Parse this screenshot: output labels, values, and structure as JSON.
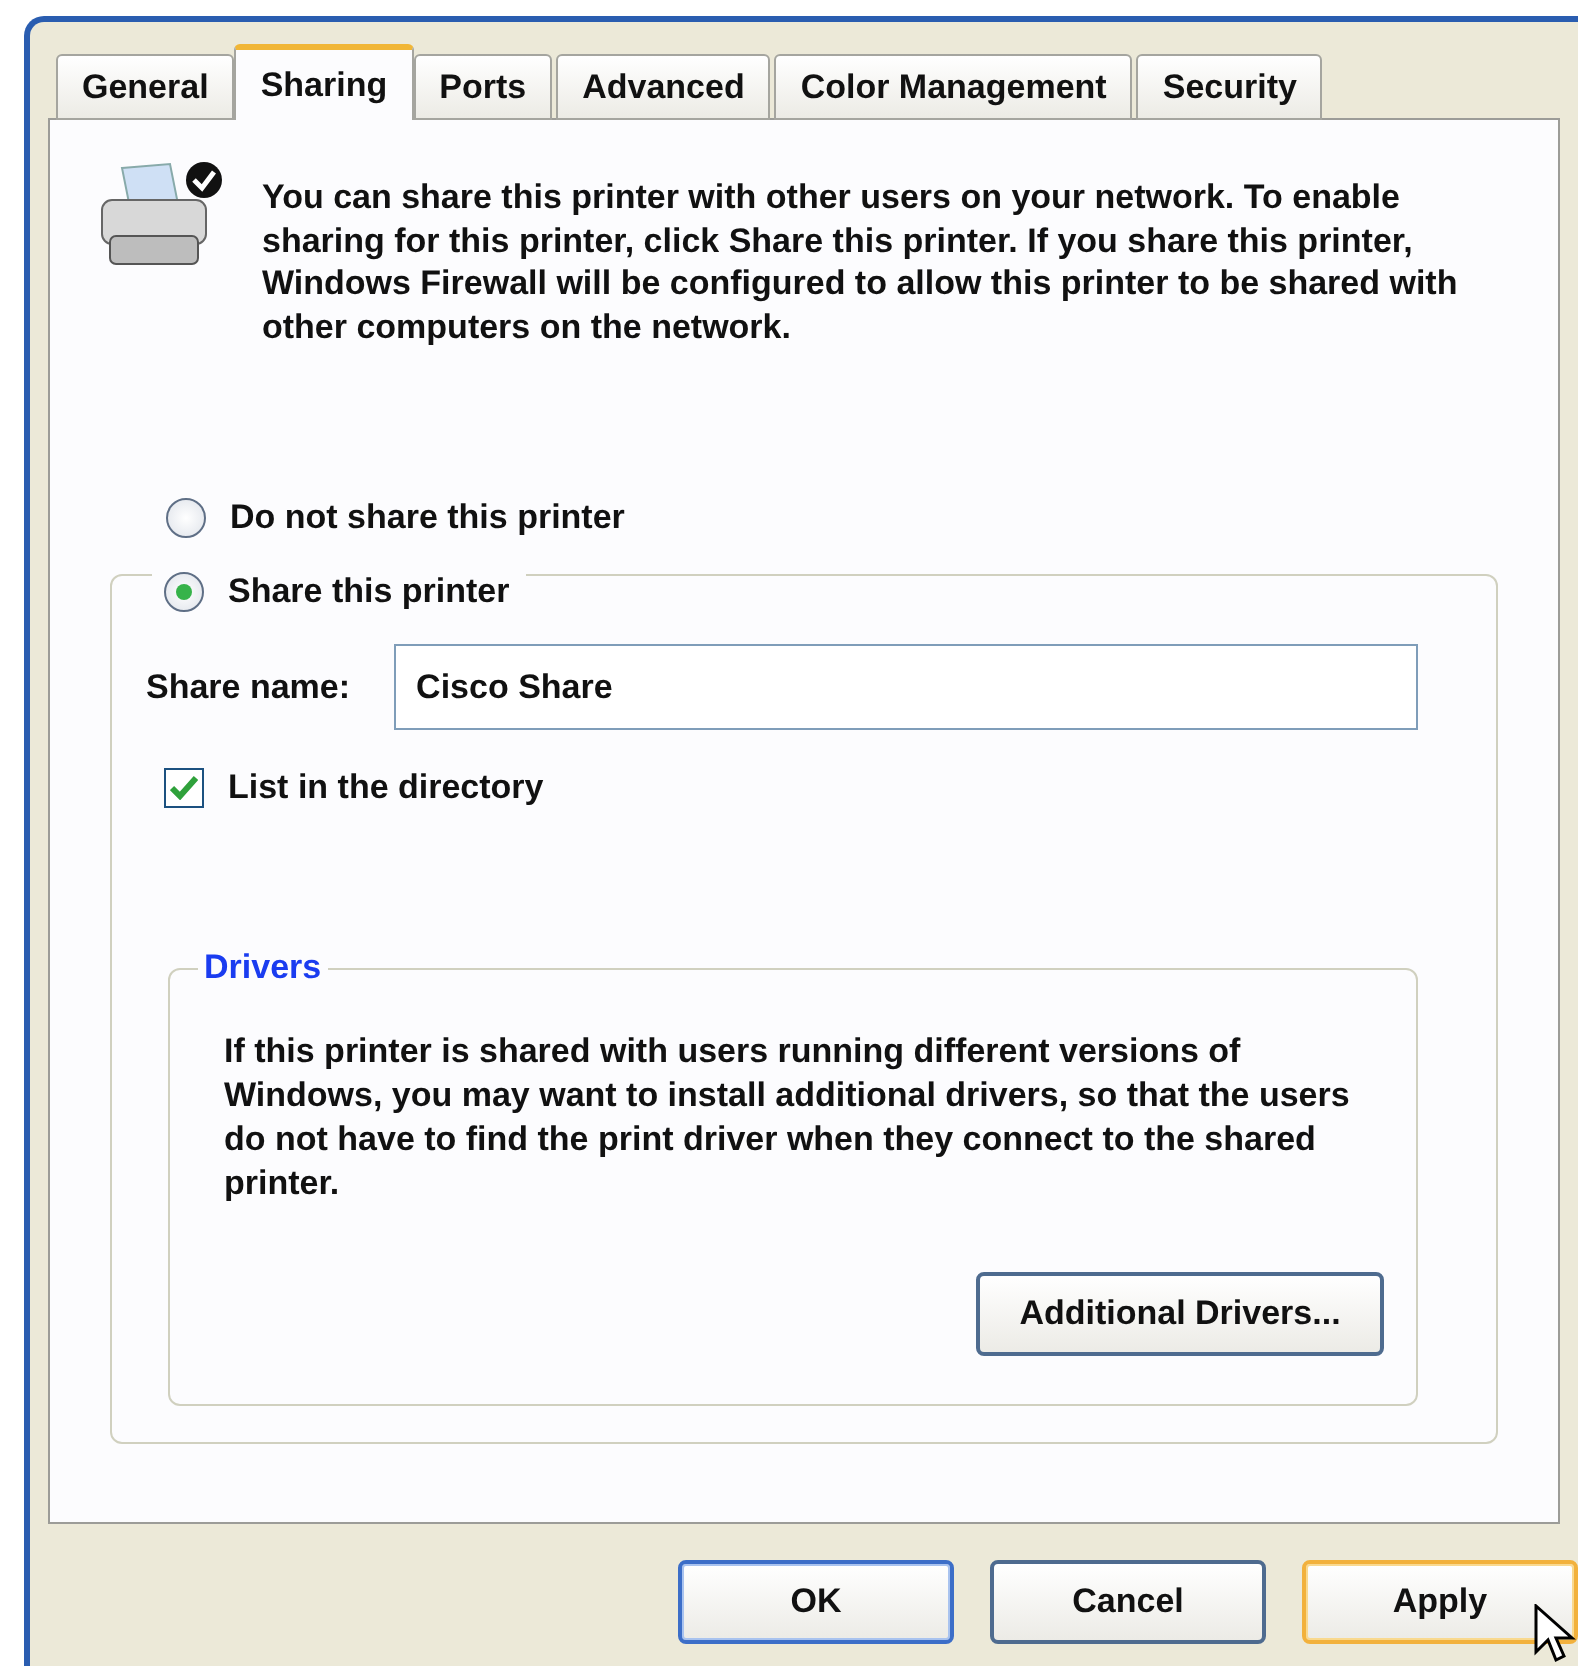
{
  "tabs": [
    {
      "label": "General",
      "selected": false
    },
    {
      "label": "Sharing",
      "selected": true
    },
    {
      "label": "Ports",
      "selected": false
    },
    {
      "label": "Advanced",
      "selected": false
    },
    {
      "label": "Color Management",
      "selected": false
    },
    {
      "label": "Security",
      "selected": false
    }
  ],
  "intro": "You can share this printer with other users on your network. To enable sharing for this printer, click Share this printer. If you share this printer, Windows Firewall will be configured to allow this printer to be shared with other computers on the network.",
  "options": [
    {
      "label": "Do not share this printer",
      "selected": false
    },
    {
      "label": "Share this printer",
      "selected": true
    }
  ],
  "share_name": {
    "label": "Share name:",
    "value": "Cisco Share"
  },
  "list_in_directory": {
    "label": "List in the directory",
    "checked": true
  },
  "drivers": {
    "title": "Drivers",
    "text": "If this printer is shared with users running different versions of Windows, you may want to install additional drivers, so that the users do not have to find the print driver when they connect to the shared printer.",
    "button": "Additional Drivers..."
  },
  "buttons": [
    {
      "label": "OK",
      "kind": "default"
    },
    {
      "label": "Cancel",
      "kind": "normal"
    },
    {
      "label": "Apply",
      "kind": "hover"
    }
  ]
}
